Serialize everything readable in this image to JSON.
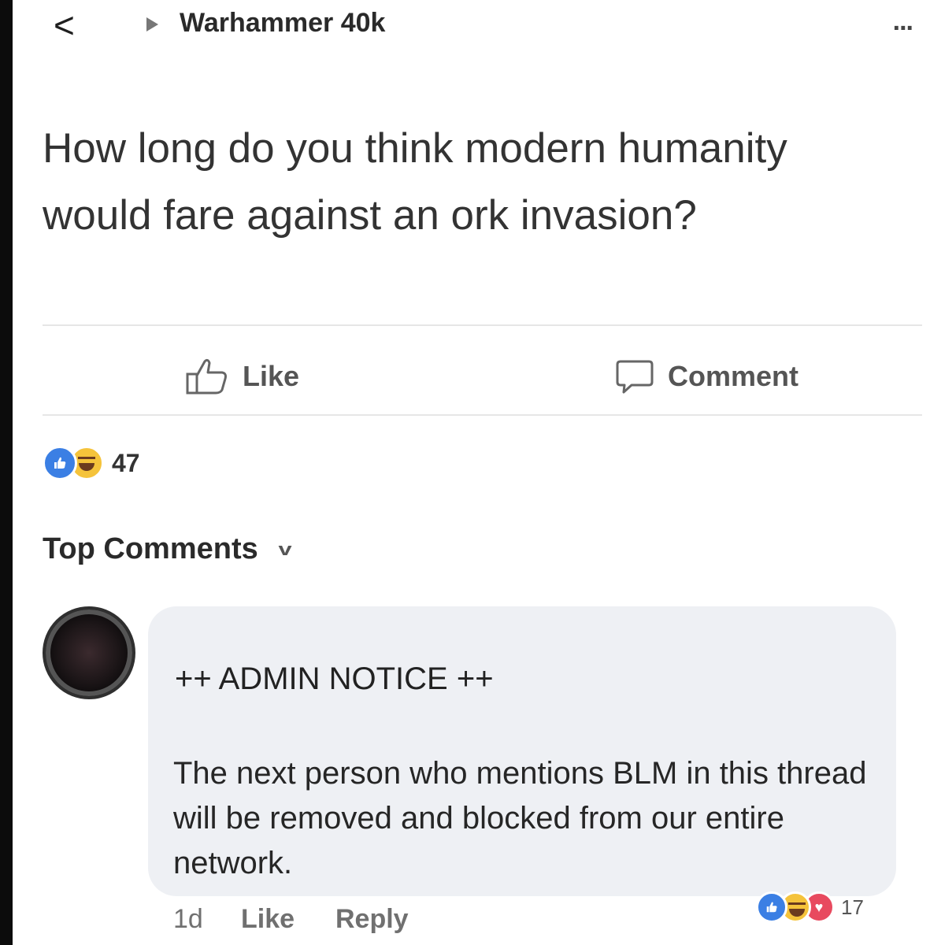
{
  "header": {
    "back_glyph": "<",
    "group_name": "Warhammer 40k",
    "more_glyph": "..."
  },
  "post": {
    "text": "How long do you think modern humanity would fare against an ork invasion?"
  },
  "actions": {
    "like_label": "Like",
    "comment_label": "Comment"
  },
  "reactions": {
    "count": "47",
    "icons": [
      "like-reaction",
      "haha-reaction"
    ]
  },
  "comments": {
    "sort_label": "Top Comments",
    "items": [
      {
        "notice": "++ ADMIN NOTICE ++",
        "body": "The next person who mentions BLM in this thread will be removed and blocked from our entire network.",
        "time": "1d",
        "like_label": "Like",
        "reply_label": "Reply",
        "reaction_count": "17",
        "reaction_icons": [
          "like-reaction",
          "haha-reaction",
          "love-reaction"
        ]
      }
    ]
  },
  "colors": {
    "like_blue": "#3b7fe4",
    "haha_yellow": "#f5c33b",
    "love_red": "#e84a5f",
    "bubble_bg": "#eef0f4"
  }
}
